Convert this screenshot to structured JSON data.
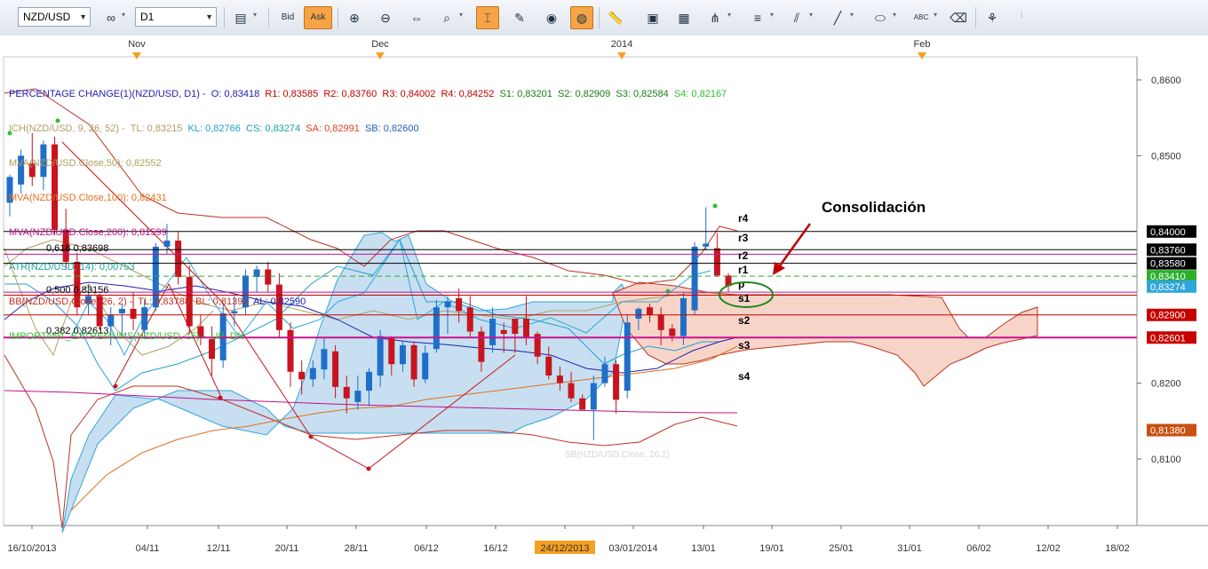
{
  "toolbar": {
    "symbol": "NZD/USD",
    "timeframe": "D1",
    "bid_label": "Bid",
    "ask_label": "Ask",
    "icons": [
      "chart-settings-icon",
      "bid-ask-icon",
      "zoom-in-icon",
      "zoom-out-icon",
      "scroll-icon",
      "magnify-icon",
      "crosshair-icon",
      "export-icon",
      "eye-icon",
      "globe-icon",
      "ruler-icon",
      "picture-icon",
      "template-icon",
      "fibonacci-icon",
      "lines-icon",
      "pitchfork-icon",
      "pencil-icon",
      "ellipse-icon",
      "text-icon",
      "eraser-icon",
      "tree-icon"
    ]
  },
  "top_axis": [
    "Nov",
    "Dec",
    "2014",
    "Feb"
  ],
  "legend": [
    {
      "text": "PERCENTAGE CHANGE(1)(NZD/USD, D1) -  O: 0,83418  R1: 0,83585  R2: 0,83760  R3: 0,84002  R4: 0,84252  S1: 0,83201  S2: 0,82909  S3: 0,82584  S4: 0,82167",
      "color": "#2020b0"
    },
    {
      "text": "ICH(NZD/USD, 9, 26, 52) -  TL: 0,83215  KL: 0,82766  CS: 0,83274  SA: 0,82991  SB: 0,82600",
      "color": "#b0a060"
    },
    {
      "text": "MVA(NZD/USD.Close,50): 0,82552",
      "color": "#b0a060"
    },
    {
      "text": "MVA(NZD/USD.Close,100): 0,82431",
      "color": "#e07020"
    },
    {
      "text": "MVA(NZD/USD.Close,200): 0,81599",
      "color": "#c0108a"
    },
    {
      "text": "ATR(NZD/USD, 14): 0,00753",
      "color": "#1aa3a3"
    },
    {
      "text": "BB(NZD/USD.Close, 26, 2) -  TL: 0,83788  BL: 0,81392  AL: 0,82590",
      "color": "#c03020"
    },
    {
      "text": "IMPORTANT_EXTREMUMS(NZD/USD, 15) -  UP  DN",
      "color": "#30c030"
    }
  ],
  "legend_segments": [
    {
      "t": "PERCENTAGE CHANGE(1)(NZD/USD, D1) -  O: 0,83418  ",
      "c": "#2020b0"
    },
    {
      "t": "R1: 0,83585  R2: 0,83760  R3: 0,84002  R4: 0,84252  ",
      "c": "#c00000"
    },
    {
      "t": "S1: 0,83201  S2: 0,82909  S3: 0,82584  ",
      "c": "#1a7a1a"
    },
    {
      "t": "S4: 0,82167",
      "c": "#30c030"
    }
  ],
  "legend_line2": [
    {
      "t": "ICH(NZD/USD, 9, 26, 52) -  TL: 0,83215  ",
      "c": "#b0a060"
    },
    {
      "t": "KL: 0,82766  ",
      "c": "#20a0d0"
    },
    {
      "t": "CS: 0,83274  ",
      "c": "#1aa3a3"
    },
    {
      "t": "SA: 0,82991  ",
      "c": "#e04020"
    },
    {
      "t": "SB: 0,82600",
      "c": "#2060c0"
    }
  ],
  "price_axis": [
    {
      "v": 0.86,
      "label": "0,8600"
    },
    {
      "v": 0.85,
      "label": "0,8500"
    },
    {
      "v": 0.82,
      "label": "0,8200"
    },
    {
      "v": 0.81,
      "label": "0,8100"
    }
  ],
  "price_tags": [
    {
      "label": "0,84000",
      "v": 0.84,
      "bg": "#000000",
      "fg": "#ffffff"
    },
    {
      "label": "0,83760",
      "v": 0.8376,
      "bg": "#000000",
      "fg": "#ffffff"
    },
    {
      "label": "0,83580",
      "v": 0.8358,
      "bg": "#000000",
      "fg": "#ffffff"
    },
    {
      "label": "0,83410",
      "v": 0.8341,
      "bg": "#2bb02b",
      "fg": "#ffffff"
    },
    {
      "label": "0,83274",
      "v": 0.83274,
      "bg": "#2fa6dc",
      "fg": "#ffffff"
    },
    {
      "label": "0,82900",
      "v": 0.829,
      "bg": "#c80000",
      "fg": "#ffffff"
    },
    {
      "label": "0,82601",
      "v": 0.82601,
      "bg": "#c80000",
      "fg": "#ffffff"
    },
    {
      "label": "0,81380",
      "v": 0.8138,
      "bg": "#c85010",
      "fg": "#ffffff"
    }
  ],
  "date_axis": [
    "16/10/2013",
    "04/11",
    "12/11",
    "20/11",
    "28/11",
    "06/12",
    "16/12",
    "24/12/2013",
    "03/01/2014",
    "13/01",
    "19/01",
    "25/01",
    "31/01",
    "06/02",
    "12/02",
    "18/02"
  ],
  "date_axis_highlight": "24/12/2013",
  "fib_labels": [
    {
      "text": "0,618  0,83698",
      "v": 0.83698
    },
    {
      "text": "0,500  0,83156",
      "v": 0.83156
    },
    {
      "text": "0,382  0,82613",
      "v": 0.82613
    }
  ],
  "pivot_labels": [
    "r4",
    "r3",
    "r2",
    "r1",
    "p",
    "s1",
    "s2",
    "s3",
    "s4"
  ],
  "annotation": "Consolidación",
  "faded_label": "SB(NZD/USD.Close, 26,2)",
  "colors": {
    "bull": "#1f6fc8",
    "bear": "#c8141e",
    "cloud_blue": "#c7dff0",
    "cloud_red": "#f6d5c8"
  },
  "chart_data": {
    "type": "candlestick",
    "ylim": [
      0.8,
      0.862
    ],
    "candles": [
      {
        "o": 0.8438,
        "h": 0.8475,
        "l": 0.842,
        "c": 0.8472
      },
      {
        "o": 0.8462,
        "h": 0.8508,
        "l": 0.845,
        "c": 0.85
      },
      {
        "o": 0.849,
        "h": 0.853,
        "l": 0.846,
        "c": 0.8472
      },
      {
        "o": 0.8472,
        "h": 0.852,
        "l": 0.8455,
        "c": 0.8515
      },
      {
        "o": 0.8515,
        "h": 0.8525,
        "l": 0.8395,
        "c": 0.8402
      },
      {
        "o": 0.8402,
        "h": 0.843,
        "l": 0.835,
        "c": 0.836
      },
      {
        "o": 0.836,
        "h": 0.8372,
        "l": 0.829,
        "c": 0.83
      },
      {
        "o": 0.8305,
        "h": 0.833,
        "l": 0.829,
        "c": 0.8315
      },
      {
        "o": 0.8315,
        "h": 0.8318,
        "l": 0.827,
        "c": 0.8275
      },
      {
        "o": 0.8275,
        "h": 0.83,
        "l": 0.825,
        "c": 0.829
      },
      {
        "o": 0.8292,
        "h": 0.8305,
        "l": 0.8262,
        "c": 0.8298
      },
      {
        "o": 0.8298,
        "h": 0.832,
        "l": 0.827,
        "c": 0.8285
      },
      {
        "o": 0.827,
        "h": 0.831,
        "l": 0.826,
        "c": 0.83
      },
      {
        "o": 0.83,
        "h": 0.8385,
        "l": 0.8295,
        "c": 0.838
      },
      {
        "o": 0.838,
        "h": 0.841,
        "l": 0.837,
        "c": 0.8388
      },
      {
        "o": 0.8388,
        "h": 0.84,
        "l": 0.833,
        "c": 0.834
      },
      {
        "o": 0.834,
        "h": 0.8355,
        "l": 0.8265,
        "c": 0.8275
      },
      {
        "o": 0.8275,
        "h": 0.829,
        "l": 0.825,
        "c": 0.826
      },
      {
        "o": 0.8258,
        "h": 0.8275,
        "l": 0.821,
        "c": 0.8232
      },
      {
        "o": 0.823,
        "h": 0.8305,
        "l": 0.822,
        "c": 0.8292
      },
      {
        "o": 0.8292,
        "h": 0.8315,
        "l": 0.8275,
        "c": 0.8295
      },
      {
        "o": 0.83,
        "h": 0.835,
        "l": 0.829,
        "c": 0.8342
      },
      {
        "o": 0.834,
        "h": 0.8355,
        "l": 0.832,
        "c": 0.835
      },
      {
        "o": 0.835,
        "h": 0.836,
        "l": 0.832,
        "c": 0.833
      },
      {
        "o": 0.833,
        "h": 0.8345,
        "l": 0.826,
        "c": 0.827
      },
      {
        "o": 0.827,
        "h": 0.828,
        "l": 0.8195,
        "c": 0.8215
      },
      {
        "o": 0.8215,
        "h": 0.823,
        "l": 0.8185,
        "c": 0.8205
      },
      {
        "o": 0.8205,
        "h": 0.823,
        "l": 0.8195,
        "c": 0.822
      },
      {
        "o": 0.8218,
        "h": 0.826,
        "l": 0.8205,
        "c": 0.8245
      },
      {
        "o": 0.8242,
        "h": 0.825,
        "l": 0.818,
        "c": 0.8195
      },
      {
        "o": 0.8195,
        "h": 0.821,
        "l": 0.816,
        "c": 0.818
      },
      {
        "o": 0.8175,
        "h": 0.821,
        "l": 0.8165,
        "c": 0.819
      },
      {
        "o": 0.819,
        "h": 0.822,
        "l": 0.817,
        "c": 0.8215
      },
      {
        "o": 0.821,
        "h": 0.827,
        "l": 0.8195,
        "c": 0.8262
      },
      {
        "o": 0.826,
        "h": 0.8262,
        "l": 0.821,
        "c": 0.8225
      },
      {
        "o": 0.8225,
        "h": 0.8255,
        "l": 0.8215,
        "c": 0.825
      },
      {
        "o": 0.825,
        "h": 0.8255,
        "l": 0.8195,
        "c": 0.8205
      },
      {
        "o": 0.8205,
        "h": 0.825,
        "l": 0.82,
        "c": 0.824
      },
      {
        "o": 0.8245,
        "h": 0.831,
        "l": 0.824,
        "c": 0.83
      },
      {
        "o": 0.83,
        "h": 0.8315,
        "l": 0.8265,
        "c": 0.8308
      },
      {
        "o": 0.8312,
        "h": 0.8325,
        "l": 0.828,
        "c": 0.8295
      },
      {
        "o": 0.83,
        "h": 0.8315,
        "l": 0.826,
        "c": 0.8268
      },
      {
        "o": 0.8268,
        "h": 0.8275,
        "l": 0.8215,
        "c": 0.8228
      },
      {
        "o": 0.825,
        "h": 0.83,
        "l": 0.824,
        "c": 0.8285
      },
      {
        "o": 0.827,
        "h": 0.828,
        "l": 0.824,
        "c": 0.8265
      },
      {
        "o": 0.8285,
        "h": 0.828,
        "l": 0.824,
        "c": 0.8265
      },
      {
        "o": 0.8285,
        "h": 0.8315,
        "l": 0.825,
        "c": 0.826
      },
      {
        "o": 0.8265,
        "h": 0.8268,
        "l": 0.8225,
        "c": 0.8235
      },
      {
        "o": 0.8235,
        "h": 0.8248,
        "l": 0.8205,
        "c": 0.821
      },
      {
        "o": 0.821,
        "h": 0.8222,
        "l": 0.819,
        "c": 0.82
      },
      {
        "o": 0.82,
        "h": 0.8215,
        "l": 0.8175,
        "c": 0.818
      },
      {
        "o": 0.818,
        "h": 0.8185,
        "l": 0.8165,
        "c": 0.8165
      },
      {
        "o": 0.8165,
        "h": 0.821,
        "l": 0.8125,
        "c": 0.82
      },
      {
        "o": 0.82,
        "h": 0.8235,
        "l": 0.8195,
        "c": 0.8225
      },
      {
        "o": 0.8225,
        "h": 0.823,
        "l": 0.816,
        "c": 0.8178
      },
      {
        "o": 0.819,
        "h": 0.829,
        "l": 0.818,
        "c": 0.828
      },
      {
        "o": 0.8285,
        "h": 0.83,
        "l": 0.827,
        "c": 0.8298
      },
      {
        "o": 0.83,
        "h": 0.8305,
        "l": 0.828,
        "c": 0.829
      },
      {
        "o": 0.829,
        "h": 0.83,
        "l": 0.825,
        "c": 0.827
      },
      {
        "o": 0.8272,
        "h": 0.8278,
        "l": 0.8255,
        "c": 0.8262
      },
      {
        "o": 0.8262,
        "h": 0.832,
        "l": 0.825,
        "c": 0.8312
      },
      {
        "o": 0.8296,
        "h": 0.8386,
        "l": 0.829,
        "c": 0.838
      },
      {
        "o": 0.838,
        "h": 0.8432,
        "l": 0.8375,
        "c": 0.8384
      },
      {
        "o": 0.8378,
        "h": 0.8398,
        "l": 0.834,
        "c": 0.8342
      },
      {
        "o": 0.8342,
        "h": 0.8345,
        "l": 0.832,
        "c": 0.8328
      }
    ]
  }
}
